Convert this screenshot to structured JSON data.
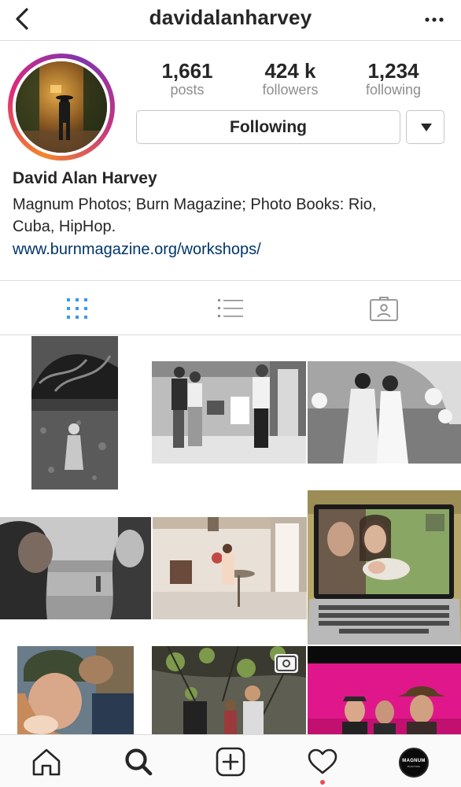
{
  "header": {
    "username": "davidalanharvey",
    "back_icon": "chevron-left-icon",
    "more_icon": "more-horizontal-icon"
  },
  "profile": {
    "stats": [
      {
        "value": "1,661",
        "label": "posts"
      },
      {
        "value": "424 k",
        "label": "followers"
      },
      {
        "value": "1,234",
        "label": "following"
      }
    ],
    "follow_button_label": "Following",
    "full_name": "David Alan Harvey",
    "bio_line1": "Magnum Photos; Burn Magazine; Photo Books: Rio,",
    "bio_line2": "Cuba, HipHop.",
    "website": "www.burnmagazine.org/workshops/"
  },
  "tabs": {
    "items": [
      "grid-icon",
      "list-icon",
      "tagged-icon"
    ],
    "active": "grid-icon",
    "active_color": "#3897f0"
  },
  "grid": {
    "badge_icon": "camera-icon"
  },
  "bottom_nav": {
    "items": [
      "home-icon",
      "search-icon",
      "add-icon",
      "heart-icon",
      "profile-avatar"
    ],
    "profile_avatar_text_1": "MAGNUM",
    "profile_avatar_text_2": "PHOTOS",
    "notification_color": "#ed4956"
  }
}
